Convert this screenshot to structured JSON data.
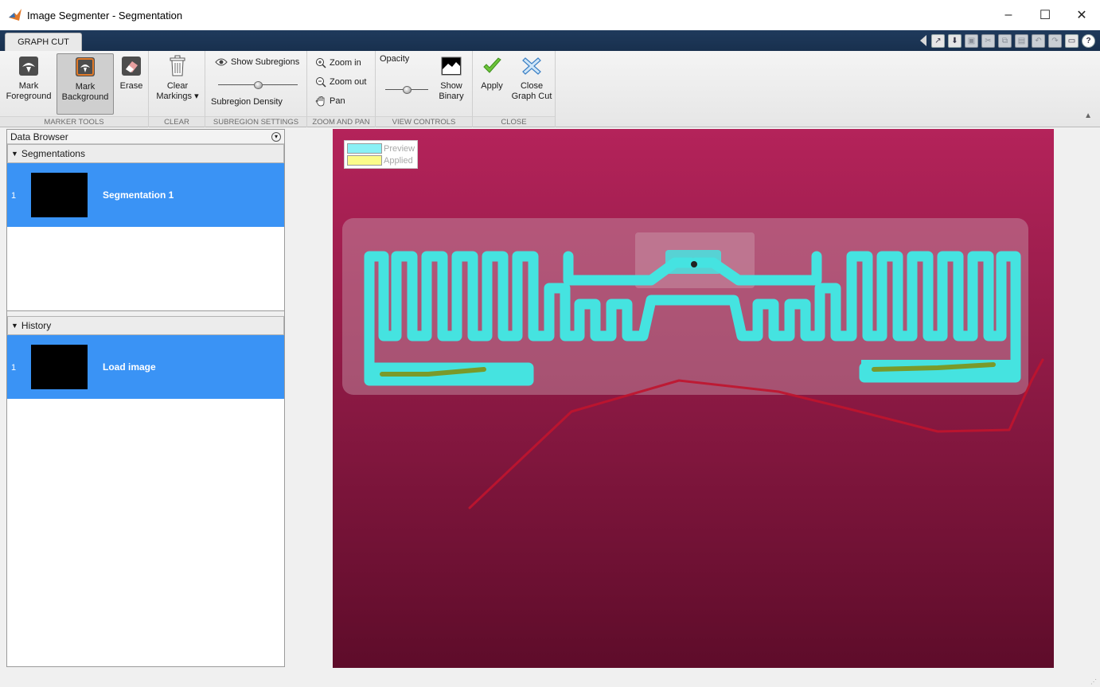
{
  "window": {
    "title": "Image Segmenter - Segmentation",
    "minimize": "–",
    "maximize": "☐",
    "close": "✕"
  },
  "tab": {
    "label": "GRAPH CUT"
  },
  "ribbon": {
    "marker_tools": {
      "label": "MARKER TOOLS",
      "mark_foreground": "Mark\nForeground",
      "mark_foreground_l1": "Mark",
      "mark_foreground_l2": "Foreground",
      "mark_background_l1": "Mark",
      "mark_background_l2": "Background",
      "erase": "Erase"
    },
    "clear": {
      "label": "CLEAR",
      "clear_l1": "Clear",
      "clear_l2": "Markings ▾"
    },
    "subregion": {
      "label": "SUBREGION SETTINGS",
      "show_subregions": "Show Subregions",
      "density": "Subregion Density",
      "density_level": 0.5
    },
    "zoom_pan": {
      "label": "ZOOM AND PAN",
      "zoom_in": "Zoom in",
      "zoom_out": "Zoom out",
      "pan": "Pan"
    },
    "view": {
      "label": "VIEW CONTROLS",
      "opacity": "Opacity",
      "opacity_level": 0.5,
      "show_binary_l1": "Show",
      "show_binary_l2": "Binary"
    },
    "close_group": {
      "label": "CLOSE",
      "apply": "Apply",
      "close_l1": "Close",
      "close_l2": "Graph Cut"
    }
  },
  "data_browser": {
    "title": "Data Browser",
    "segmentations_header": "Segmentations",
    "segmentations": [
      {
        "index": "1",
        "name": "Segmentation 1"
      }
    ],
    "history_header": "History",
    "history": [
      {
        "index": "1",
        "name": "Load image"
      }
    ]
  },
  "legend": {
    "preview": "Preview",
    "applied": "Applied",
    "preview_color": "#8af0f5",
    "applied_color": "#fbfb8a"
  },
  "colors": {
    "selection": "#3a93f5",
    "background_image": "#8e1a45",
    "foreground_overlay": "#45e3e0",
    "foreground_marker": "#7a9a2a",
    "background_marker": "#c0142e",
    "tab_strip": "#1f3a5c"
  }
}
